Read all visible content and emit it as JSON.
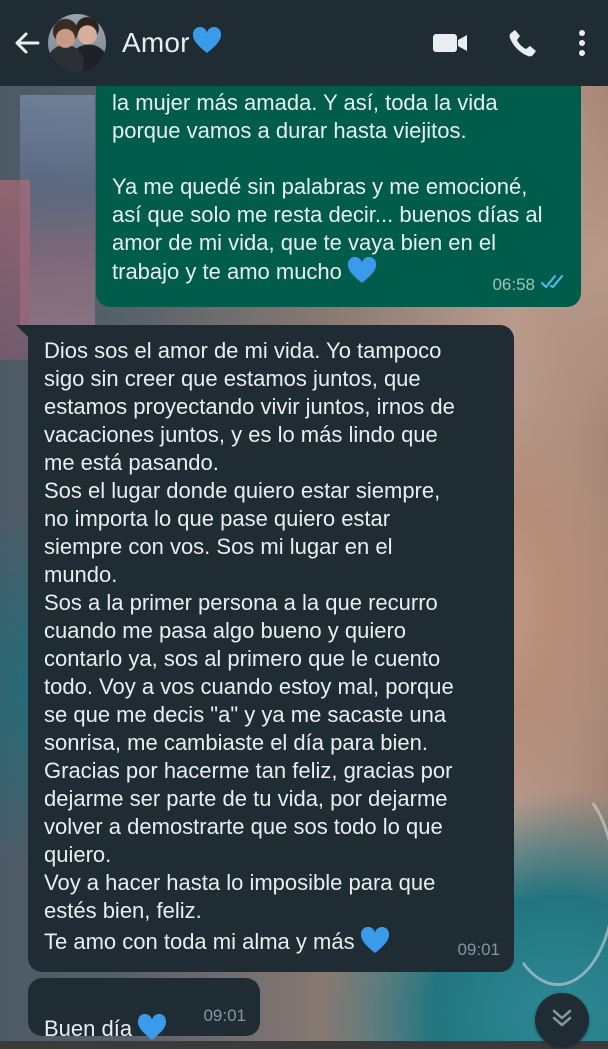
{
  "header": {
    "title": "Amor",
    "title_emoji": "blue-heart-icon"
  },
  "messages": {
    "outgoing": {
      "paragraph1": "la mujer más amada. Y así, toda la vida porque vamos a durar hasta viejitos.",
      "paragraph2": "Ya me quedé sin palabras y me emocioné, así que solo me resta decir... buenos días al amor de mi vida, que te vaya bien en el trabajo y te amo mucho",
      "time": "06:58",
      "status": "read-double-check-icon"
    },
    "incoming1": {
      "lines": [
        "Dios sos el amor de mi vida. Yo tampoco",
        "sigo sin creer que estamos juntos,  que",
        "estamos proyectando vivir juntos,  irnos de",
        "vacaciones juntos, y es lo más lindo que",
        "me está pasando.",
        "Sos el lugar donde quiero estar siempre,",
        "no importa lo que pase quiero estar",
        "siempre con vos. Sos mi lugar en el",
        "mundo.",
        "Sos a la primer persona a la que recurro",
        "cuando me pasa algo bueno y quiero",
        "contarlo ya, sos al primero que le cuento",
        "todo. Voy a vos cuando estoy mal, porque",
        "se que me decis \"a\" y ya me sacaste una",
        "sonrisa, me cambiaste el día para bien.",
        "Gracias por hacerme tan feliz, gracias por",
        "dejarme ser parte de tu vida, por dejarme",
        "volver a demostrarte que sos todo lo que",
        "quiero.",
        "Voy a hacer hasta lo imposible para que",
        "estés bien, feliz."
      ],
      "last_line": "Te amo con toda mi alma y más",
      "time": "09:01"
    },
    "incoming2": {
      "text": "Buen día",
      "time": "09:01"
    }
  },
  "colors": {
    "header_bg": "#1f2c34",
    "outgoing_bg": "#005c4b",
    "incoming_bg": "#1f2c34",
    "read_tick": "#53bdeb",
    "heart": "#3a9bea"
  }
}
